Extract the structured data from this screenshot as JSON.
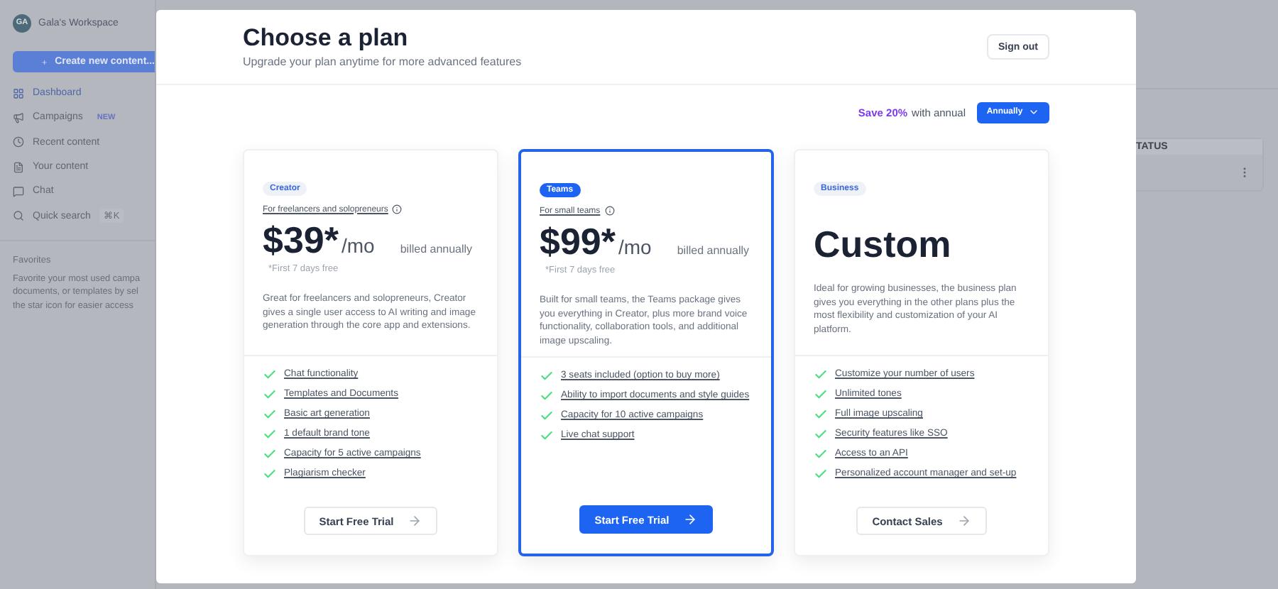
{
  "sidebar": {
    "workspace": {
      "initials": "GA",
      "name": "Gala's Workspace"
    },
    "create_button": "Create new content...",
    "items": [
      {
        "label": "Dashboard",
        "selected": true
      },
      {
        "label": "Campaigns",
        "selected": false,
        "badge": "NEW"
      },
      {
        "label": "Recent content",
        "selected": false
      },
      {
        "label": "Your content",
        "selected": false
      },
      {
        "label": "Chat",
        "selected": false
      },
      {
        "label": "Quick search",
        "selected": false,
        "shortcut": "⌘K"
      }
    ],
    "favorites": {
      "title": "Favorites",
      "lines": [
        "Favorite your most used campa",
        "documents, or templates by sel",
        "the star icon for easier access"
      ]
    }
  },
  "table": {
    "column_header": "TATUS"
  },
  "modal": {
    "title": "Choose a plan",
    "subtitle": "Upgrade your plan anytime for more advanced features",
    "sign_out": "Sign out",
    "billing": {
      "save": "Save 20%",
      "note": "with annual",
      "select": "Annually"
    },
    "plans": [
      {
        "kind": "priced",
        "badge": "Creator",
        "selected": false,
        "audience": "For freelancers and solopreneurs",
        "price": "$39*",
        "period": "/mo",
        "billing": "billed annually",
        "trial": "*First 7 days free",
        "description": "Great for freelancers and solopreneurs, Creator gives a single user access to AI writing and image generation through the core app and extensions.",
        "features": [
          "Chat functionality",
          "Templates and Documents",
          "Basic art generation",
          "1 default brand tone",
          "Capacity for 5 active campaigns",
          "Plagiarism checker"
        ],
        "cta": "Start Free Trial"
      },
      {
        "kind": "priced",
        "badge": "Teams",
        "selected": true,
        "audience": "For small teams",
        "price": "$99*",
        "period": "/mo",
        "billing": "billed annually",
        "trial": "*First 7 days free",
        "description": "Built for small teams, the Teams package gives you everything in Creator, plus more brand voice functionality, collaboration tools, and additional image upscaling.",
        "features": [
          "3 seats included (option to buy more)",
          "Ability to import documents and style guides",
          "Capacity for 10 active campaigns",
          "Live chat support"
        ],
        "cta": "Start Free Trial"
      },
      {
        "kind": "custom",
        "badge": "Business",
        "selected": false,
        "price": "Custom",
        "description": "Ideal for growing businesses, the business plan gives you everything in the other plans plus the most flexibility and customization of your AI platform.",
        "features": [
          "Customize your number of users",
          "Unlimited tones",
          "Full image upscaling",
          "Security features like SSO",
          "Access to an API",
          "Personalized account manager and set-up"
        ],
        "cta": "Contact Sales"
      }
    ]
  }
}
